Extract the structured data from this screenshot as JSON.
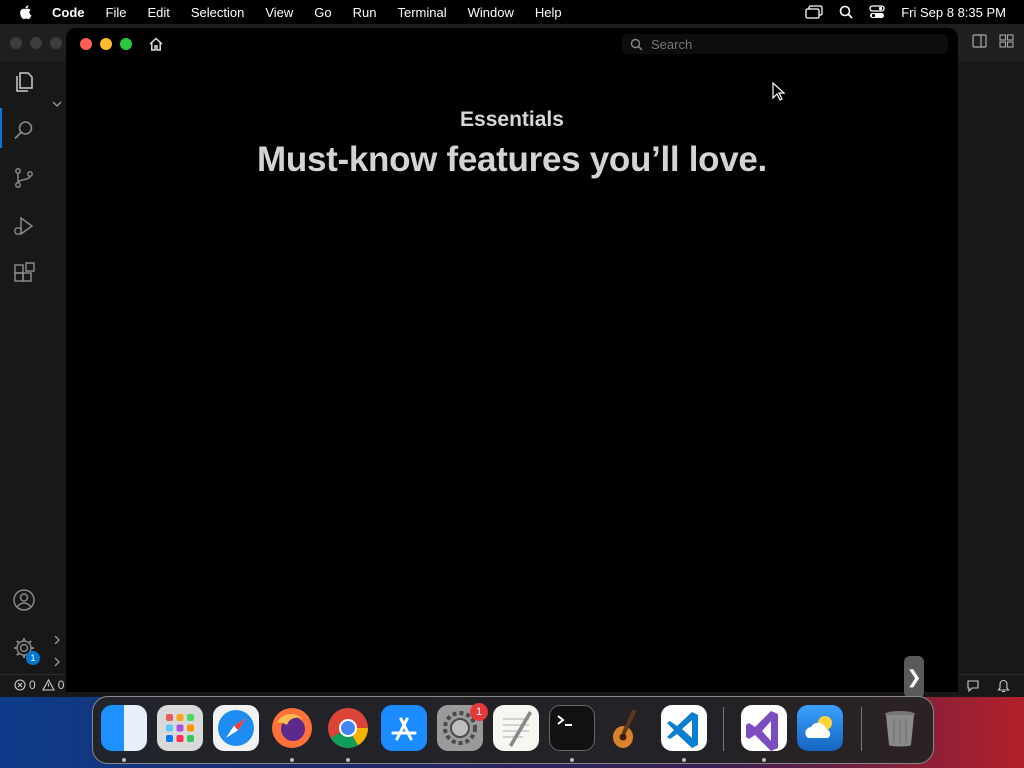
{
  "menubar": {
    "apple_icon": "apple-logo",
    "app_name": "Code",
    "items": [
      "File",
      "Edit",
      "Selection",
      "View",
      "Go",
      "Run",
      "Terminal",
      "Window",
      "Help"
    ],
    "clock": "Fri Sep 8  8:35 PM"
  },
  "tips_window": {
    "search_placeholder": "Search",
    "eyebrow": "Essentials",
    "headline": "Must-know features you’ll love.",
    "next_glyph": "❯"
  },
  "vscode": {
    "activity_icons": [
      "explorer-icon",
      "search-icon",
      "source-control-icon",
      "run-debug-icon",
      "extensions-icon"
    ],
    "accounts_icon": "account-icon",
    "manage_icon": "gear-icon",
    "manage_badge": "1",
    "status": {
      "errors": "0",
      "warnings": "0"
    }
  },
  "dock": {
    "items": [
      "Finder",
      "Launchpad",
      "Safari",
      "Firefox",
      "Chrome",
      "App Store",
      "System Settings",
      "TextEdit",
      "Terminal",
      "GarageBand",
      "Visual Studio Code",
      "Visual Studio",
      "Weather",
      "Trash"
    ],
    "settings_badge": "1"
  }
}
